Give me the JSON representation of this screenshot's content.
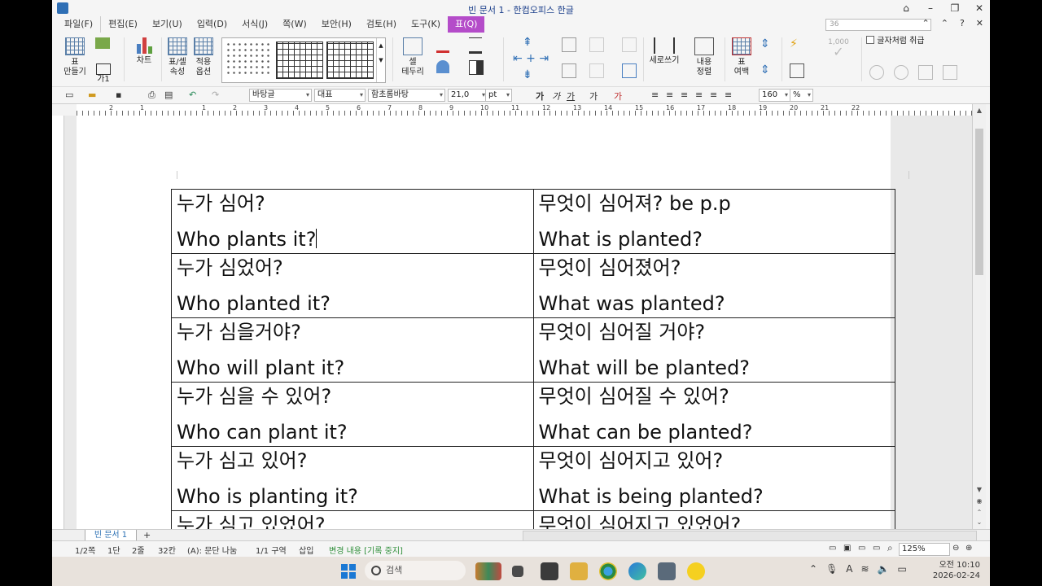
{
  "window": {
    "title": "빈 문서 1 - 한컴오피스 한글"
  },
  "menu": {
    "items": [
      "파일(F)",
      "편집(E)",
      "보기(U)",
      "입력(D)",
      "서식(J)",
      "쪽(W)",
      "보안(H)",
      "검토(H)",
      "도구(K)",
      "표(Q)"
    ],
    "active": "표(Q)",
    "zoom_box": "36"
  },
  "ribbon": {
    "make_table": "표\n만들기",
    "ga1": "가1",
    "chart": "차트",
    "cell_props": "표/셀\n속성",
    "apply_opts": "적용\n옵션",
    "cell_border": "셀\n테두리",
    "vertical_write": "세로쓰기",
    "content_align": "내용\n정렬",
    "table_margin": "표\n여백",
    "num_value": "1,000",
    "char_treat": "글자처럼 취급"
  },
  "toolbar": {
    "style": "바탕글",
    "lang": "대표",
    "font": "함초롬바탕",
    "size": "21,0",
    "unit": "pt",
    "spacing": "160",
    "pct": "%"
  },
  "table": {
    "rows": [
      {
        "ko_q": "누가 심어?",
        "en_q": "Who plants it?",
        "ko_a": "무엇이 심어져? be p.p",
        "en_a": "What is planted?"
      },
      {
        "ko_q": "누가 심었어?",
        "en_q": "Who planted it?",
        "ko_a": "무엇이 심어졌어?",
        "en_a": "What was planted?"
      },
      {
        "ko_q": "누가 심을거야?",
        "en_q": "Who will plant it?",
        "ko_a": "무엇이 심어질 거야?",
        "en_a": "What will be planted?"
      },
      {
        "ko_q": "누가 심을 수 있어?",
        "en_q": "Who can plant it?",
        "ko_a": "무엇이 심어질 수 있어?",
        "en_a": "What can be planted?"
      },
      {
        "ko_q": "누가 심고 있어?",
        "en_q": "Who is planting it?",
        "ko_a": "무엇이 심어지고 있어?",
        "en_a": "What is being planted?"
      },
      {
        "ko_q": "누가 심고 있었어?",
        "en_q": "",
        "ko_a": "무엇이 심어지고 있었어?",
        "en_a": ""
      }
    ]
  },
  "tabs": {
    "doc_tab": "빈 문서 1",
    "add": "+"
  },
  "status": {
    "page": "1/2쪽",
    "section": "1단",
    "line": "2줄",
    "col": "32칸",
    "mode": "(A): 문단 나눔",
    "area": "1/1 구역",
    "insert": "삽입",
    "track": "변경 내용 [기록 중지]",
    "zoom": "125%"
  },
  "taskbar": {
    "search": "검색",
    "time": "오전 10:10",
    "date": "2026-02-24"
  }
}
